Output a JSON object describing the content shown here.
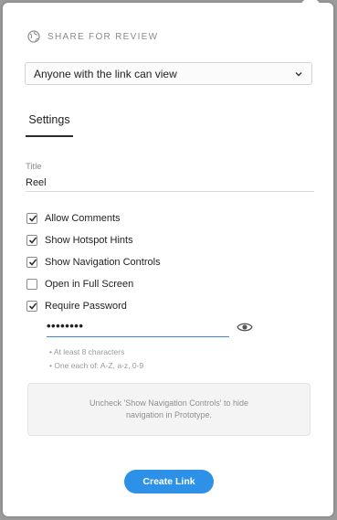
{
  "header": {
    "title": "SHARE FOR REVIEW",
    "icon": "globe-icon"
  },
  "access_select": {
    "value": "Anyone with the link can view"
  },
  "tabs": [
    {
      "label": "Settings"
    }
  ],
  "title_field": {
    "label": "Title",
    "value": "Reel"
  },
  "options": [
    {
      "label": "Allow Comments",
      "checked": true
    },
    {
      "label": "Show Hotspot Hints",
      "checked": true
    },
    {
      "label": "Show Navigation Controls",
      "checked": true
    },
    {
      "label": "Open in Full Screen",
      "checked": false
    },
    {
      "label": "Require Password",
      "checked": true
    }
  ],
  "password": {
    "masked_value": "••••••••"
  },
  "password_hints": [
    "• At least 8 characters",
    "• One each of: A-Z, a-z, 0-9"
  ],
  "info_note": "Uncheck 'Show Navigation Controls' to hide navigation in Prototype.",
  "create_button": {
    "label": "Create Link"
  },
  "colors": {
    "accent": "#2d91e8",
    "input_focus": "#3a85d8"
  }
}
